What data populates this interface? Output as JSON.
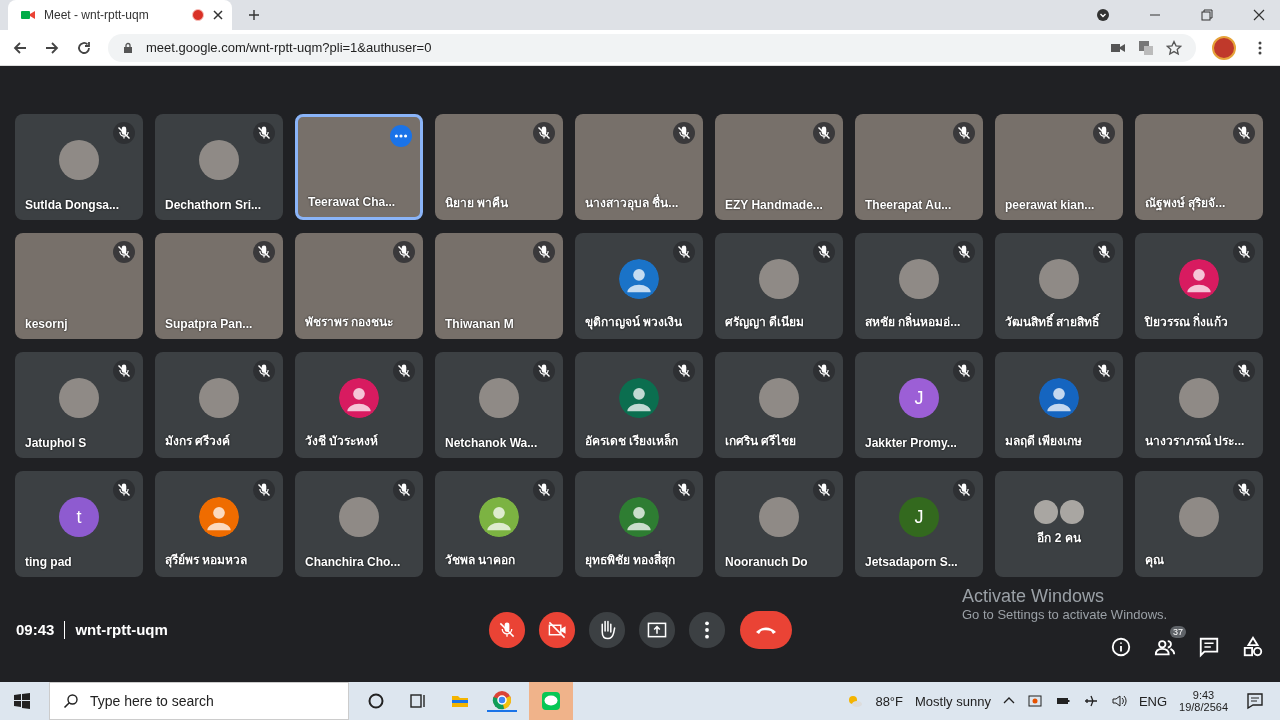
{
  "browser": {
    "tab_title": "Meet - wnt-rptt-uqm",
    "url": "meet.google.com/wnt-rptt-uqm?pli=1&authuser=0"
  },
  "tiles": [
    {
      "name": "Sutlda Dongsa...",
      "kind": "photo",
      "muted": true,
      "highlighted": false
    },
    {
      "name": "Dechathorn Sri...",
      "kind": "photo",
      "muted": true,
      "highlighted": false
    },
    {
      "name": "Teerawat Cha...",
      "kind": "video",
      "muted": false,
      "highlighted": true
    },
    {
      "name": "นิยาย พาคืน",
      "kind": "video",
      "muted": true,
      "highlighted": false
    },
    {
      "name": "นางสาวอุบล ชื่น...",
      "kind": "video",
      "muted": true,
      "highlighted": false
    },
    {
      "name": "EZY Handmade...",
      "kind": "video",
      "muted": true,
      "highlighted": false
    },
    {
      "name": "Theerapat Au...",
      "kind": "video",
      "muted": true,
      "highlighted": false
    },
    {
      "name": "peerawat kian...",
      "kind": "video",
      "muted": true,
      "highlighted": false
    },
    {
      "name": "ณัฐพงษ์ สุริยจั...",
      "kind": "video",
      "muted": true,
      "highlighted": false
    },
    {
      "name": "kesornj",
      "kind": "video",
      "muted": true,
      "highlighted": false
    },
    {
      "name": "Supatpra Pan...",
      "kind": "video",
      "muted": true,
      "highlighted": false
    },
    {
      "name": "พัชราพร กองชนะ",
      "kind": "video",
      "muted": true,
      "highlighted": false
    },
    {
      "name": "Thiwanan M",
      "kind": "video",
      "muted": true,
      "highlighted": false
    },
    {
      "name": "ขุติกาญจน์ พวงเงิน",
      "kind": "silhouette",
      "color": "#1a73c8",
      "muted": true,
      "highlighted": false
    },
    {
      "name": "ศรัญญา ดีเนียม",
      "kind": "photo",
      "muted": true,
      "highlighted": false
    },
    {
      "name": "สหชัย กลิ่นหอมอ่...",
      "kind": "photo",
      "muted": true,
      "highlighted": false
    },
    {
      "name": "วัฒนสิทธิ์ สายสิทธิ์",
      "kind": "photo",
      "muted": true,
      "highlighted": false
    },
    {
      "name": "ปิยวรรณ กิ่งแก้ว",
      "kind": "silhouette",
      "color": "#d81b60",
      "muted": true,
      "highlighted": false
    },
    {
      "name": "Jatuphol S",
      "kind": "photo",
      "muted": true,
      "highlighted": false
    },
    {
      "name": "มังกร ศรีวงค์",
      "kind": "photo",
      "muted": true,
      "highlighted": false
    },
    {
      "name": "วังชี บัวระหงห์",
      "kind": "silhouette",
      "color": "#d81b60",
      "muted": true,
      "highlighted": false
    },
    {
      "name": "Netchanok Wa...",
      "kind": "photo",
      "muted": true,
      "highlighted": false
    },
    {
      "name": "อัครเดช เรียงเหล็ก",
      "kind": "silhouette",
      "color": "#0b6e4f",
      "muted": true,
      "highlighted": false
    },
    {
      "name": "เกศริน ศรีไชย",
      "kind": "photo",
      "muted": true,
      "highlighted": false
    },
    {
      "name": "Jakkter Promy...",
      "kind": "initial",
      "initial": "J",
      "color": "#9c5fd6",
      "muted": true,
      "highlighted": false
    },
    {
      "name": "มลฤดี เพียงเกษ",
      "kind": "silhouette",
      "color": "#1565c0",
      "muted": true,
      "highlighted": false
    },
    {
      "name": "นางวราภรณ์ ประ...",
      "kind": "photo",
      "muted": true,
      "highlighted": false
    },
    {
      "name": "ting pad",
      "kind": "initial",
      "initial": "t",
      "color": "#8e5bd0",
      "muted": true,
      "highlighted": false
    },
    {
      "name": "สุรีย์พร หอมหวล",
      "kind": "silhouette",
      "color": "#ef6c00",
      "muted": true,
      "highlighted": false
    },
    {
      "name": "Chanchira Cho...",
      "kind": "photo",
      "muted": true,
      "highlighted": false
    },
    {
      "name": "วัชพล นาคอก",
      "kind": "silhouette",
      "color": "#7cb342",
      "muted": true,
      "highlighted": false
    },
    {
      "name": "ยุทธพิชัย ทองสี่สุก",
      "kind": "silhouette",
      "color": "#2e7d32",
      "muted": true,
      "highlighted": false
    },
    {
      "name": "Nooranuch Do",
      "kind": "photo",
      "muted": true,
      "highlighted": false
    },
    {
      "name": "Jetsadaporn S...",
      "kind": "initial",
      "initial": "J",
      "color": "#33691e",
      "muted": true,
      "highlighted": false
    },
    {
      "name": "อีก 2 คน",
      "kind": "group",
      "muted": false,
      "highlighted": false
    },
    {
      "name": "คุณ",
      "kind": "photo",
      "muted": true,
      "highlighted": false
    }
  ],
  "meeting": {
    "time": "09:43",
    "code": "wnt-rptt-uqm",
    "participant_count": "37"
  },
  "activation": {
    "title": "Activate Windows",
    "subtitle": "Go to Settings to activate Windows."
  },
  "taskbar": {
    "search_placeholder": "Type here to search",
    "temperature": "88°F",
    "weather": "Mostly sunny",
    "language": "ENG",
    "time": "9:43",
    "date": "19/8/2564"
  }
}
